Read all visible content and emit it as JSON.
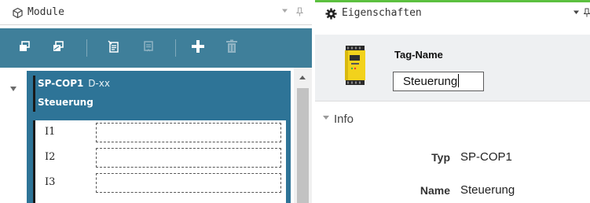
{
  "modules_panel": {
    "title": "Module",
    "title_icon": "module-cube-icon",
    "controls": {
      "dropdown_icon": "dropdown-arrow-icon",
      "pin_icon": "pin-icon"
    },
    "toolbar": {
      "background": "#3f7f9a",
      "buttons": [
        {
          "icon": "copy-module-icon"
        },
        {
          "icon": "paste-module-icon"
        },
        {
          "icon": "edit-list-icon"
        },
        {
          "icon": "edit-list-disabled-icon"
        },
        {
          "icon": "add-icon"
        },
        {
          "icon": "delete-icon"
        }
      ]
    },
    "module": {
      "name": "SP-COP1",
      "variant": "D-xx",
      "tag": "Steuerung",
      "card_color": "#2e7497",
      "io_rows": [
        {
          "label": "I1",
          "value": ""
        },
        {
          "label": "I2",
          "value": ""
        },
        {
          "label": "I3",
          "value": ""
        }
      ]
    }
  },
  "properties_panel": {
    "title": "Eigenschaften",
    "title_icon": "gear-icon",
    "accent": "#5cc03f",
    "controls": {
      "dropdown_icon": "dropdown-arrow-icon",
      "pin_icon": "pin-icon"
    },
    "tag_name_label": "Tag-Name",
    "tag_name_value": "Steuerung",
    "device_icon": "safety-controller-device-icon",
    "info": {
      "label": "Info",
      "rows": [
        {
          "key": "Typ",
          "value": "SP-COP1"
        },
        {
          "key": "Name",
          "value": "Steuerung"
        }
      ]
    }
  }
}
